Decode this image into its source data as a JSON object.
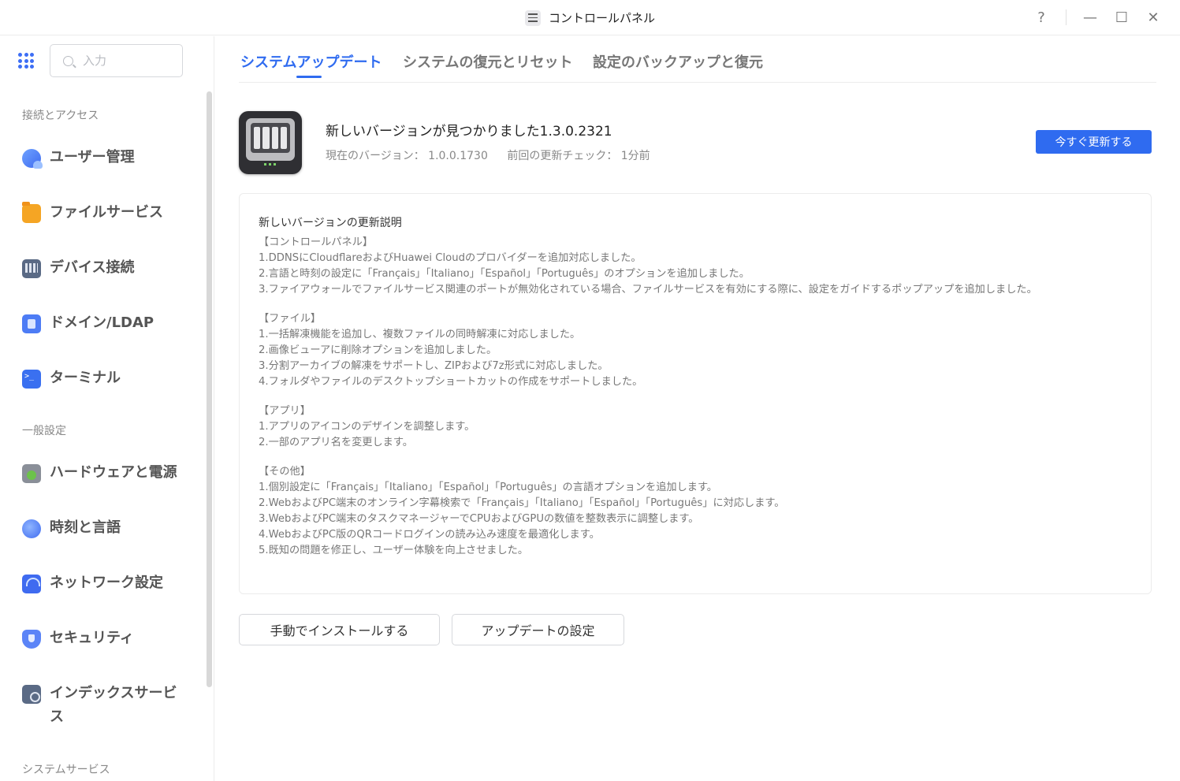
{
  "window": {
    "title": "コントロールパネル",
    "help_label": "?",
    "minimize_label": "—",
    "maximize_label": "☐",
    "close_label": "✕"
  },
  "sidebar": {
    "search_placeholder": "入力",
    "sections": [
      {
        "label": "接続とアクセス"
      },
      {
        "label": "一般設定"
      },
      {
        "label": "システムサービス"
      }
    ],
    "items": [
      {
        "label": "ユーザー管理",
        "icon": "users-icon"
      },
      {
        "label": "ファイルサービス",
        "icon": "folder-icon"
      },
      {
        "label": "デバイス接続",
        "icon": "device-icon"
      },
      {
        "label": "ドメイン/LDAP",
        "icon": "domain-icon"
      },
      {
        "label": "ターミナル",
        "icon": "terminal-icon"
      },
      {
        "label": "ハードウェアと電源",
        "icon": "hardware-icon"
      },
      {
        "label": "時刻と言語",
        "icon": "globe-icon"
      },
      {
        "label": "ネットワーク設定",
        "icon": "network-icon"
      },
      {
        "label": "セキュリティ",
        "icon": "shield-icon"
      },
      {
        "label": "インデックスサービス",
        "icon": "index-icon"
      }
    ]
  },
  "tabs": [
    {
      "label": "システムアップデート",
      "active": true
    },
    {
      "label": "システムの復元とリセット",
      "active": false
    },
    {
      "label": "設定のバックアップと復元",
      "active": false
    }
  ],
  "update": {
    "title": "新しいバージョンが見つかりました1.3.0.2321",
    "current_version": "現在のバージョン： 1.0.0.1730",
    "last_check": "前回の更新チェック： 1分前",
    "update_now_label": "今すぐ更新する"
  },
  "notes": {
    "title": "新しいバージョンの更新説明",
    "groups": [
      {
        "heading": "【コントロールパネル】",
        "lines": [
          "1.DDNSにCloudflareおよびHuawei Cloudのプロバイダーを追加対応しました。",
          "2.言語と時刻の設定に「Français」「Italiano」「Español」「Português」のオプションを追加しました。",
          "3.ファイアウォールでファイルサービス関連のポートが無効化されている場合、ファイルサービスを有効にする際に、設定をガイドするポップアップを追加しました。"
        ]
      },
      {
        "heading": "【ファイル】",
        "lines": [
          "1.一括解凍機能を追加し、複数ファイルの同時解凍に対応しました。",
          "2.画像ビューアに削除オプションを追加しました。",
          "3.分割アーカイブの解凍をサポートし、ZIPおよび7z形式に対応しました。",
          "4.フォルダやファイルのデスクトップショートカットの作成をサポートしました。"
        ]
      },
      {
        "heading": "【アプリ】",
        "lines": [
          "1.アプリのアイコンのデザインを調整します。",
          "2.一部のアプリ名を変更します。"
        ]
      },
      {
        "heading": "【その他】",
        "lines": [
          "1.個別設定に「Français」「Italiano」「Español」「Português」の言語オプションを追加します。",
          "2.WebおよびPC端末のオンライン字幕検索で「Français」「Italiano」「Español」「Português」に対応します。",
          "3.WebおよびPC端末のタスクマネージャーでCPUおよびGPUの数値を整数表示に調整します。",
          "4.WebおよびPC版のQRコードログインの読み込み速度を最適化します。",
          "5.既知の問題を修正し、ユーザー体験を向上させました。"
        ]
      }
    ]
  },
  "actions": {
    "manual_install_label": "手動でインストールする",
    "update_settings_label": "アップデートの設定"
  },
  "colors": {
    "accent": "#2f6bf0"
  }
}
